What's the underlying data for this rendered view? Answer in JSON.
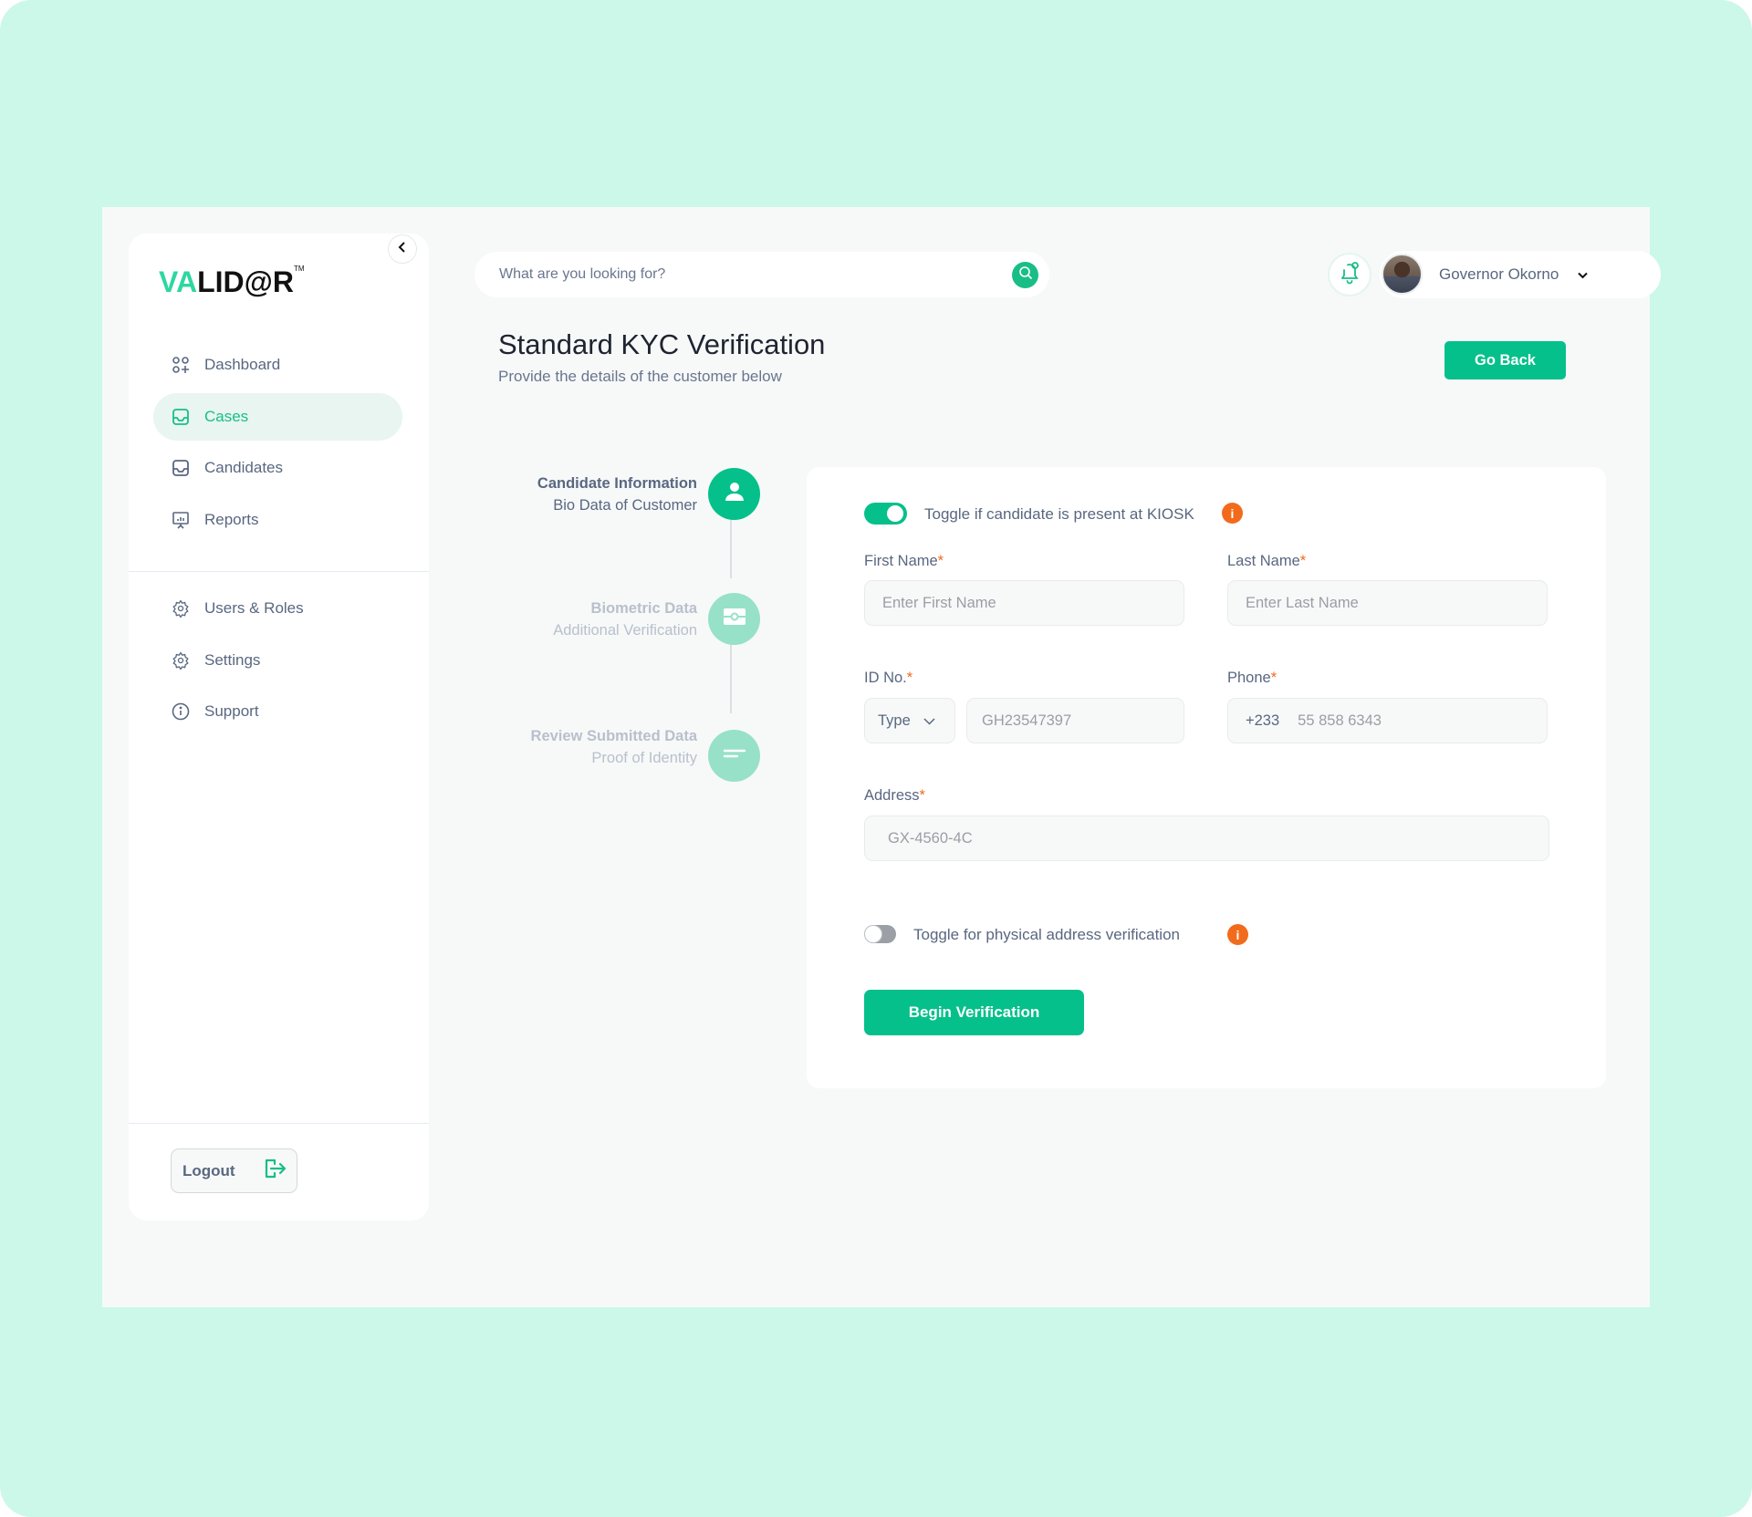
{
  "brand": {
    "logo_prefix": "VA",
    "logo_suffix": "LID@R",
    "logo_tm": "TM",
    "accent_color": "#05c08a",
    "warning_color": "#f26b1d"
  },
  "sidebar": {
    "main_items": [
      {
        "label": "Dashboard",
        "icon": "dashboard-grid-icon",
        "active": false
      },
      {
        "label": "Cases",
        "icon": "inbox-tray-icon",
        "active": true
      },
      {
        "label": "Candidates",
        "icon": "inbox-tray-icon",
        "active": false
      },
      {
        "label": "Reports",
        "icon": "presentation-chart-icon",
        "active": false
      }
    ],
    "secondary_items": [
      {
        "label": "Users & Roles",
        "icon": "gear-icon"
      },
      {
        "label": "Settings",
        "icon": "gear-icon"
      },
      {
        "label": "Support",
        "icon": "info-circle-icon"
      }
    ],
    "logout_label": "Logout"
  },
  "header": {
    "search_placeholder": "What are you looking for?",
    "user_name": "Governor Okorno"
  },
  "page": {
    "title": "Standard KYC Verification",
    "subtitle": "Provide the details of the customer below",
    "go_back_label": "Go Back"
  },
  "stepper": [
    {
      "title": "Candidate Information",
      "subtitle": "Bio Data of Customer",
      "icon": "user-icon",
      "active": true
    },
    {
      "title": "Biometric Data",
      "subtitle": "Additional Verification",
      "icon": "fingerprint-scanner-icon",
      "active": false
    },
    {
      "title": "Review Submitted Data",
      "subtitle": "Proof of Identity",
      "icon": "text-lines-icon",
      "active": false
    }
  ],
  "form": {
    "kiosk_toggle": {
      "label": "Toggle if candidate is present at KIOSK",
      "on": true
    },
    "first_name": {
      "label": "First Name",
      "required": "*",
      "placeholder": "Enter First Name",
      "value": ""
    },
    "last_name": {
      "label": "Last Name",
      "required": "*",
      "placeholder": "Enter Last Name",
      "value": ""
    },
    "id_no": {
      "label": "ID No.",
      "required": "*",
      "type_label": "Type",
      "placeholder": "GH23547397",
      "value": ""
    },
    "phone": {
      "label": "Phone",
      "required": "*",
      "country_code": "+233",
      "placeholder": "55 858 6343",
      "value": ""
    },
    "address": {
      "label": "Address",
      "required": "*",
      "placeholder": "GX-4560-4C",
      "value": ""
    },
    "address_toggle": {
      "label": "Toggle for physical address verification",
      "on": false
    },
    "submit_label": "Begin Verification",
    "info_glyph": "i"
  }
}
